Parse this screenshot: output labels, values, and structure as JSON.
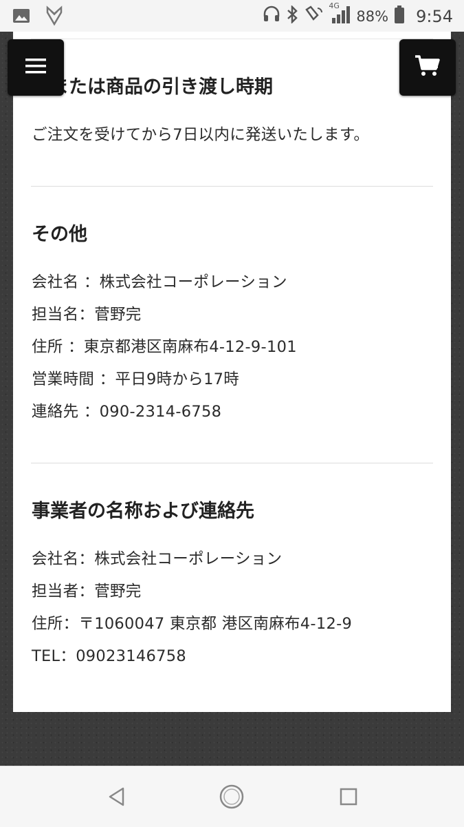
{
  "status_bar": {
    "battery_percent": "88%",
    "time": "9:54",
    "network": "4G",
    "icons": [
      "image-icon",
      "app-shield-icon",
      "headset-icon",
      "bluetooth-icon",
      "nfc-icon",
      "signal-icon",
      "battery-icon"
    ]
  },
  "header": {
    "menu_icon": "hamburger-icon",
    "cart_icon": "cart-icon"
  },
  "sections": [
    {
      "title": "務または商品の引き渡し時期",
      "lines": [
        "ご注文を受けてから7日以内に発送いたします。"
      ]
    },
    {
      "title": "その他",
      "lines": [
        "会社名 ：株式会社コーポレーション",
        "担当名：菅野完",
        "住所 ：東京都港区南麻布4-12-9-101",
        "営業時間 ：平日9時から17時",
        "連絡先 ：090-2314-6758"
      ]
    },
    {
      "title": "事業者の名称および連絡先",
      "lines": [
        "会社名：株式会社コーポレーション",
        "担当者：菅野完",
        "住所：〒1060047 東京都 港区南麻布4-12-9",
        "TEL：09023146758"
      ]
    }
  ],
  "nav_bar": {
    "back_icon": "back-triangle-icon",
    "home_icon": "home-circle-icon",
    "recents_icon": "recents-square-icon"
  },
  "colors": {
    "background": "#3a3a3a",
    "card": "#ffffff",
    "button": "#111111",
    "text": "#222222"
  }
}
